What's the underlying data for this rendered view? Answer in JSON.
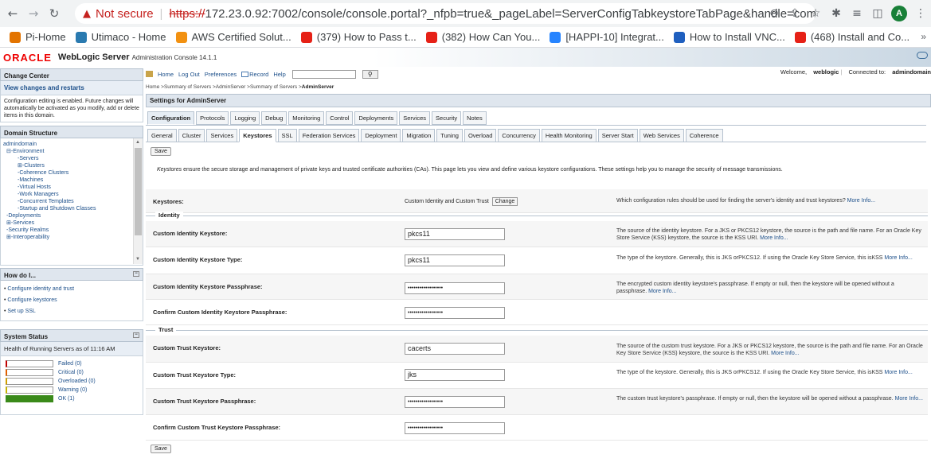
{
  "browser": {
    "security_label": "Not secure",
    "url_scheme": "https://",
    "url_rest": "172.23.0.92:7002/console/console.portal?_nfpb=true&_pageLabel=ServerConfigTabkeystoreTabPage&handle=com.bea.cons...",
    "profile_initial": "A",
    "bookmarks": [
      {
        "label": "Pi-Home",
        "icon": "pi-icon",
        "color": "#e37400"
      },
      {
        "label": "Utimaco - Home",
        "icon": "utimaco-icon",
        "color": "#2a7ab0"
      },
      {
        "label": "AWS Certified Solut...",
        "icon": "aws-icon",
        "color": "#f29111"
      },
      {
        "label": "(379) How to Pass t...",
        "icon": "youtube-icon",
        "color": "#e62117"
      },
      {
        "label": "(382) How Can You...",
        "icon": "youtube-icon",
        "color": "#e62117"
      },
      {
        "label": "[HAPPI-10] Integrat...",
        "icon": "jira-icon",
        "color": "#2684ff"
      },
      {
        "label": "How to Install VNC...",
        "icon": "info-icon",
        "color": "#1f5fbf"
      },
      {
        "label": "(468) Install and Co...",
        "icon": "youtube-icon",
        "color": "#e62117"
      }
    ]
  },
  "header": {
    "oracle": "ORACLE",
    "product": "WebLogic Server",
    "sub": "Administration Console 14.1.1"
  },
  "change_center": {
    "title": "Change Center",
    "link": "View changes and restarts",
    "text": "Configuration editing is enabled. Future changes will automatically be activated as you modify, add or delete items in this domain."
  },
  "domain_structure": {
    "title": "Domain Structure",
    "items": [
      {
        "label": "admindomain",
        "level": 0
      },
      {
        "label": "⊟-Environment",
        "level": 1
      },
      {
        "label": "-Servers",
        "level": 2
      },
      {
        "label": "⊞-Clusters",
        "level": 2
      },
      {
        "label": "-Coherence Clusters",
        "level": 2
      },
      {
        "label": "-Machines",
        "level": 2
      },
      {
        "label": "-Virtual Hosts",
        "level": 2
      },
      {
        "label": "-Work Managers",
        "level": 2
      },
      {
        "label": "-Concurrent Templates",
        "level": 2
      },
      {
        "label": "-Startup and Shutdown Classes",
        "level": 2
      },
      {
        "label": "-Deployments",
        "level": 1
      },
      {
        "label": "⊞-Services",
        "level": 1
      },
      {
        "label": "-Security Realms",
        "level": 1
      },
      {
        "label": "⊞-Interoperability",
        "level": 1
      }
    ]
  },
  "how_do_i": {
    "title": "How do I...",
    "items": [
      "Configure identity and trust",
      "Configure keystores",
      "Set up SSL"
    ]
  },
  "system_status": {
    "title": "System Status",
    "health": "Health of Running Servers as of  11:16 AM",
    "rows": [
      {
        "label": "Failed (0)",
        "color": "#c00000",
        "fill": 0
      },
      {
        "label": "Critical (0)",
        "color": "#e06000",
        "fill": 0
      },
      {
        "label": "Overloaded (0)",
        "color": "#d0a000",
        "fill": 0
      },
      {
        "label": "Warning (0)",
        "color": "#c8b400",
        "fill": 0
      },
      {
        "label": "OK (1)",
        "color": "#3a8a1a",
        "fill": 1
      }
    ]
  },
  "toolbar": {
    "home": "Home",
    "logout": "Log Out",
    "preferences": "Preferences",
    "record": "Record",
    "help": "Help",
    "welcome_prefix": "Welcome, ",
    "user": "weblogic",
    "connected_prefix": "Connected to: ",
    "domain": "admindomain"
  },
  "breadcrumb": {
    "path": "Home >Summary of Servers >AdminServer >Summary of Servers >",
    "current": "AdminServer"
  },
  "settings_title": "Settings for AdminServer",
  "tabs_main": [
    "Configuration",
    "Protocols",
    "Logging",
    "Debug",
    "Monitoring",
    "Control",
    "Deployments",
    "Services",
    "Security",
    "Notes"
  ],
  "tabs_sub": [
    "General",
    "Cluster",
    "Services",
    "Keystores",
    "SSL",
    "Federation Services",
    "Deployment",
    "Migration",
    "Tuning",
    "Overload",
    "Concurrency",
    "Health Monitoring",
    "Server Start",
    "Web Services",
    "Coherence"
  ],
  "save_label": "Save",
  "description": {
    "italic": "Keystores",
    "rest": " ensure the secure storage and management of private keys and trusted certificate authorities (CAs). This page lets you view and define various keystore configurations. These settings help you to manage the security of message transmissions."
  },
  "keystores": {
    "label": "Keystores:",
    "value": "Custom Identity and Custom Trust",
    "change": "Change",
    "desc": "Which configuration rules should be used for finding the server's identity and trust keystores?",
    "more": "More Info..."
  },
  "identity_title": "Identity",
  "trust_title": "Trust",
  "fields": {
    "cid_ks": {
      "label": "Custom Identity Keystore:",
      "value": "pkcs11",
      "desc": "The source of the identity keystore. For a JKS or PKCS12 keystore, the source is the path and file name. For an Oracle Key Store Service (KSS) keystore, the source is the KSS URI.",
      "more": "More Info..."
    },
    "cid_type": {
      "label": "Custom Identity Keystore Type:",
      "value": "pkcs11",
      "desc": "The type of the keystore. Generally, this is JKS orPKCS12. If using the Oracle Key Store Service, this isKSS",
      "more": "More Info..."
    },
    "cid_pass": {
      "label": "Custom Identity Keystore Passphrase:",
      "value": "••••••••••••••••••",
      "desc": "The encrypted custom identity keystore's passphrase. If empty or null, then the keystore will be opened without a passphrase.",
      "more": "More Info..."
    },
    "cid_confirm": {
      "label": "Confirm Custom Identity Keystore Passphrase:",
      "value": "••••••••••••••••••"
    },
    "ct_ks": {
      "label": "Custom Trust Keystore:",
      "value": "cacerts",
      "desc": "The source of the custom trust keystore. For a JKS or PKCS12 keystore, the source is the path and file name. For an Oracle Key Store Service (KSS) keystore, the source is the KSS URI.",
      "more": "More Info..."
    },
    "ct_type": {
      "label": "Custom Trust Keystore Type:",
      "value": "jks",
      "desc": "The type of the keystore. Generally, this is JKS orPKCS12. If using the Oracle Key Store Service, this isKSS",
      "more": "More Info..."
    },
    "ct_pass": {
      "label": "Custom Trust Keystore Passphrase:",
      "value": "••••••••••••••••••",
      "desc": "The custom trust keystore's passphrase. If empty or null, then the keystore will be opened without a passphrase.",
      "more": "More Info..."
    },
    "ct_confirm": {
      "label": "Confirm Custom Trust Keystore Passphrase:",
      "value": "••••••••••••••••••"
    }
  }
}
